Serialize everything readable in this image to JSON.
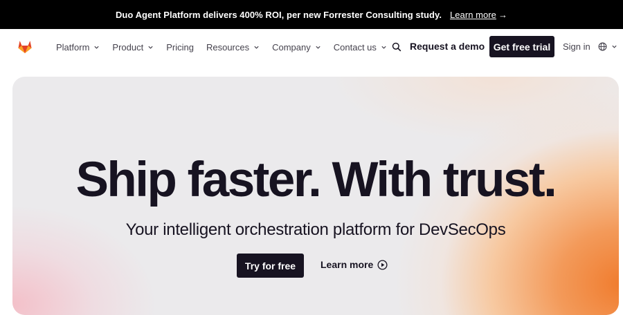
{
  "banner": {
    "text": "Duo Agent Platform delivers 400% ROI, per new Forrester Consulting study.",
    "link_label": "Learn more",
    "arrow": "→"
  },
  "nav": {
    "logo_icon": "gitlab-tanuki-icon",
    "items": [
      {
        "label": "Platform",
        "has_dropdown": true
      },
      {
        "label": "Product",
        "has_dropdown": true
      },
      {
        "label": "Pricing",
        "has_dropdown": false
      },
      {
        "label": "Resources",
        "has_dropdown": true
      },
      {
        "label": "Company",
        "has_dropdown": true
      },
      {
        "label": "Contact us",
        "has_dropdown": true
      }
    ],
    "search_icon": "search-icon",
    "request_demo": "Request a demo",
    "free_trial": "Get free trial",
    "sign_in": "Sign in",
    "language_icon": "globe-icon"
  },
  "hero": {
    "headline": "Ship faster. With trust.",
    "subheadline": "Your intelligent orchestration platform for DevSecOps",
    "primary_cta": "Try for free",
    "secondary_cta": "Learn more",
    "secondary_icon": "play-circle-icon"
  },
  "colors": {
    "banner_bg": "#000000",
    "dark_button": "#171321",
    "brand_orange": "#fc6d26",
    "brand_red": "#e24329"
  }
}
